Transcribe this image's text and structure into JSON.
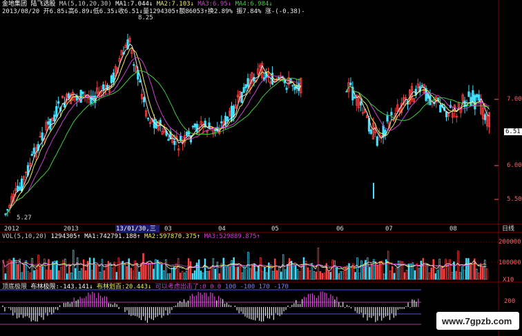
{
  "header": {
    "stock_name": "金地集团",
    "indicator_name": "陆飞选股",
    "ma_label": "MA(5,10,20,30)",
    "ma1": "MA1:7.044↓",
    "ma2": "MA2:7.103↓",
    "ma3": "MA3:6.95↓",
    "ma4": "MA4:6.984↓",
    "quote_line": "2013/08/20 开6.85↓高6.89↓低6.35↓收6.51↓量1294305↑额86053↑换2.89% 振7.84% 涨-(-0.38)-"
  },
  "price_panel": {
    "labels": {
      "high_mark": "8.25",
      "low_mark": "5.27",
      "current": "6.51"
    },
    "y_ticks": [
      "7.00",
      "6.00",
      "5.50"
    ],
    "x_labels": [
      "2012",
      "2013",
      "13/01/30,三",
      "03",
      "04",
      "05",
      "06",
      "07",
      "08",
      "日线"
    ]
  },
  "volume_panel": {
    "title": "VOL(5,10,20)",
    "vol": "1294305↑",
    "ma1": "MA1:742791.188↑",
    "ma2": "MA2:597870.375↑",
    "ma3": "MA3:529889.875↑",
    "y_ticks": [
      "200000",
      "100000",
      "X10"
    ]
  },
  "indicator_panel": {
    "title": "顶底极限",
    "v1": "布林极限:-143.141↓",
    "v2": "布林划百:20.443↓",
    "v3": "可以考虑出击了:0 0 0",
    "levels": "100  -100  170  -170",
    "y_tick": "200"
  },
  "watermark": "www.7gpzb.com",
  "colors": {
    "up": "#ff4040",
    "down": "#40e0ff",
    "ma_white": "#e8e8e8",
    "ma_yellow": "#f0f060",
    "ma_purple": "#d040d0",
    "ma_green": "#40d040",
    "grid_red": "#7a0000"
  }
}
